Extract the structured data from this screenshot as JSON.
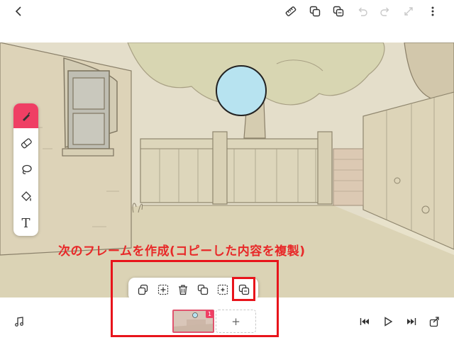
{
  "annotation": {
    "text": "次のフレームを作成(コピーした内容を複製)",
    "color": "#e82828"
  },
  "toolbar": {
    "back": "back-arrow-icon",
    "ruler": "ruler-icon",
    "layer_copy": "copy-layer-icon",
    "layer_dup": "duplicate-icon",
    "undo": "undo-icon",
    "redo": "redo-icon",
    "fullscreen": "expand-icon",
    "menu": "more-vertical-icon"
  },
  "tools": {
    "active": "pen",
    "accent": "#ef3f64",
    "items": [
      "pen-icon",
      "eraser-icon",
      "lasso-icon",
      "fill-bucket-icon",
      "text-tool-icon"
    ],
    "text_tool_glyph": "T"
  },
  "frame_popup": {
    "actions": [
      "copy-frame",
      "paste-into-frame",
      "delete-frame",
      "duplicate-frame",
      "insert-frame",
      "create-next-frame-from-copy"
    ],
    "highlighted": "create-next-frame-from-copy"
  },
  "timeline": {
    "frames": [
      {
        "number": "1"
      }
    ],
    "add_label": "+"
  },
  "playback": {
    "music": "music-note-icon",
    "first": "skip-to-start-icon",
    "play": "play-icon",
    "last": "skip-to-end-icon",
    "export": "export-icon"
  }
}
